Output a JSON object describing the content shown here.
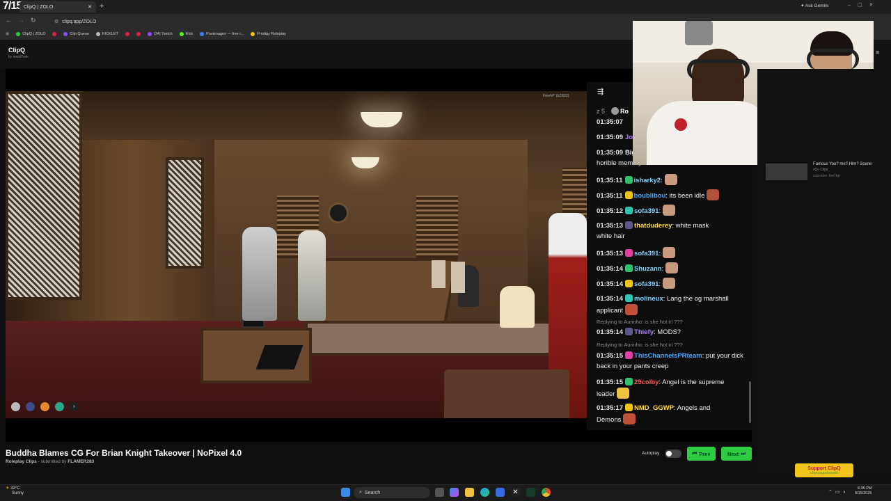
{
  "browser": {
    "overlay_time": "7/15",
    "tab_title": "ClipQ | ZOLO",
    "url": "clipq.app/ZOLO",
    "ask_gemini": "Ask Gemini",
    "bookmarks": [
      "ClipQ | ZOLO",
      "Clip Queue",
      "KICKLET",
      "(34) Twitch",
      "Kick",
      "Postimages — free i...",
      "Prodigy Roleplay"
    ]
  },
  "site": {
    "brand": "ClipQ",
    "brand_sub": "by awaitTask"
  },
  "video": {
    "watermark": "FiveM* (b2802)",
    "title": "Buddha Blames CG For Brian Knight Takeover | NoPixel 4.0",
    "category": "Roleplay Clips",
    "submitted_prefix": "- submitted by",
    "submitter": "FLAMER283"
  },
  "chat": {
    "top_partial": "z 5",
    "top_partial_name": "Ro",
    "messages": [
      {
        "time": "01:35:07",
        "user": "",
        "text": "",
        "color": "#ffffff"
      },
      {
        "time": "01:35:09",
        "user": "Joy",
        "text": "",
        "color": "#b080ff"
      },
      {
        "time": "01:35:09",
        "user": "Big",
        "text": "",
        "color": "#ffffff",
        "cont": "horible mem...y ..."
      },
      {
        "time": "01:35:11",
        "user": "isharky2",
        "text": ":",
        "color": "#7fd4ff"
      },
      {
        "time": "01:35:11",
        "user": "boublibou",
        "text": ": its been idle",
        "color": "#4aa8ff"
      },
      {
        "time": "01:35:12",
        "user": "sofa391",
        "text": ":",
        "color": "#7fd4ff"
      },
      {
        "time": "01:35:13",
        "user": "thatduderey",
        "text": ": white mask",
        "color": "#ffd84a",
        "cont": "white hair"
      },
      {
        "time": "01:35:13",
        "user": "sofa391",
        "text": ":",
        "color": "#7fd4ff"
      },
      {
        "time": "01:35:14",
        "user": "Shuzann",
        "text": ":",
        "color": "#7fd4ff"
      },
      {
        "time": "01:35:14",
        "user": "sofa391",
        "text": ":",
        "color": "#7fd4ff"
      },
      {
        "time": "01:35:14",
        "user": "molineux",
        "text": ": Lang the og marshall",
        "color": "#7fd4ff",
        "cont": "applicant"
      },
      {
        "time": "01:35:14",
        "user": "Thiefy",
        "text": ": MODS?",
        "color": "#b080ff",
        "reply": "Replying to Aurinho: is she hot irl ???"
      },
      {
        "time": "01:35:15",
        "user": "ThisChannelsPRteam",
        "text": ": put your dick",
        "color": "#4aa8ff",
        "cont": "back in your pants creep",
        "reply": "Replying to Aurinho: is she hot irl ???"
      },
      {
        "time": "01:35:15",
        "user": "29colby",
        "text": ": Angel is the supreme",
        "color": "#ff5a5a",
        "cont": "leader"
      },
      {
        "time": "01:35:17",
        "user": "NMD_GGWP",
        "text": ": Angels and",
        "color": "#ffd84a",
        "cont": "Demons"
      }
    ]
  },
  "sidebar": {
    "recent_title": "Famous You? me? Him? Scene",
    "recent_sub": "xQc Clips",
    "recent_sub2": "submitter 1neTap"
  },
  "controls": {
    "autoplay_label": "Autoplay",
    "prev_label": "Prev",
    "next_label": "Next",
    "support_label": "Support ClipQ",
    "support_sub": "clipq.app/donate"
  },
  "taskbar": {
    "weather_temp": "32°C",
    "weather_desc": "Sunny",
    "search_label": "Search",
    "time": "6:35 PM",
    "date": "8/15/2026"
  },
  "colors": {
    "accent_green": "#2ecc40",
    "support_yellow": "#f0c419"
  }
}
